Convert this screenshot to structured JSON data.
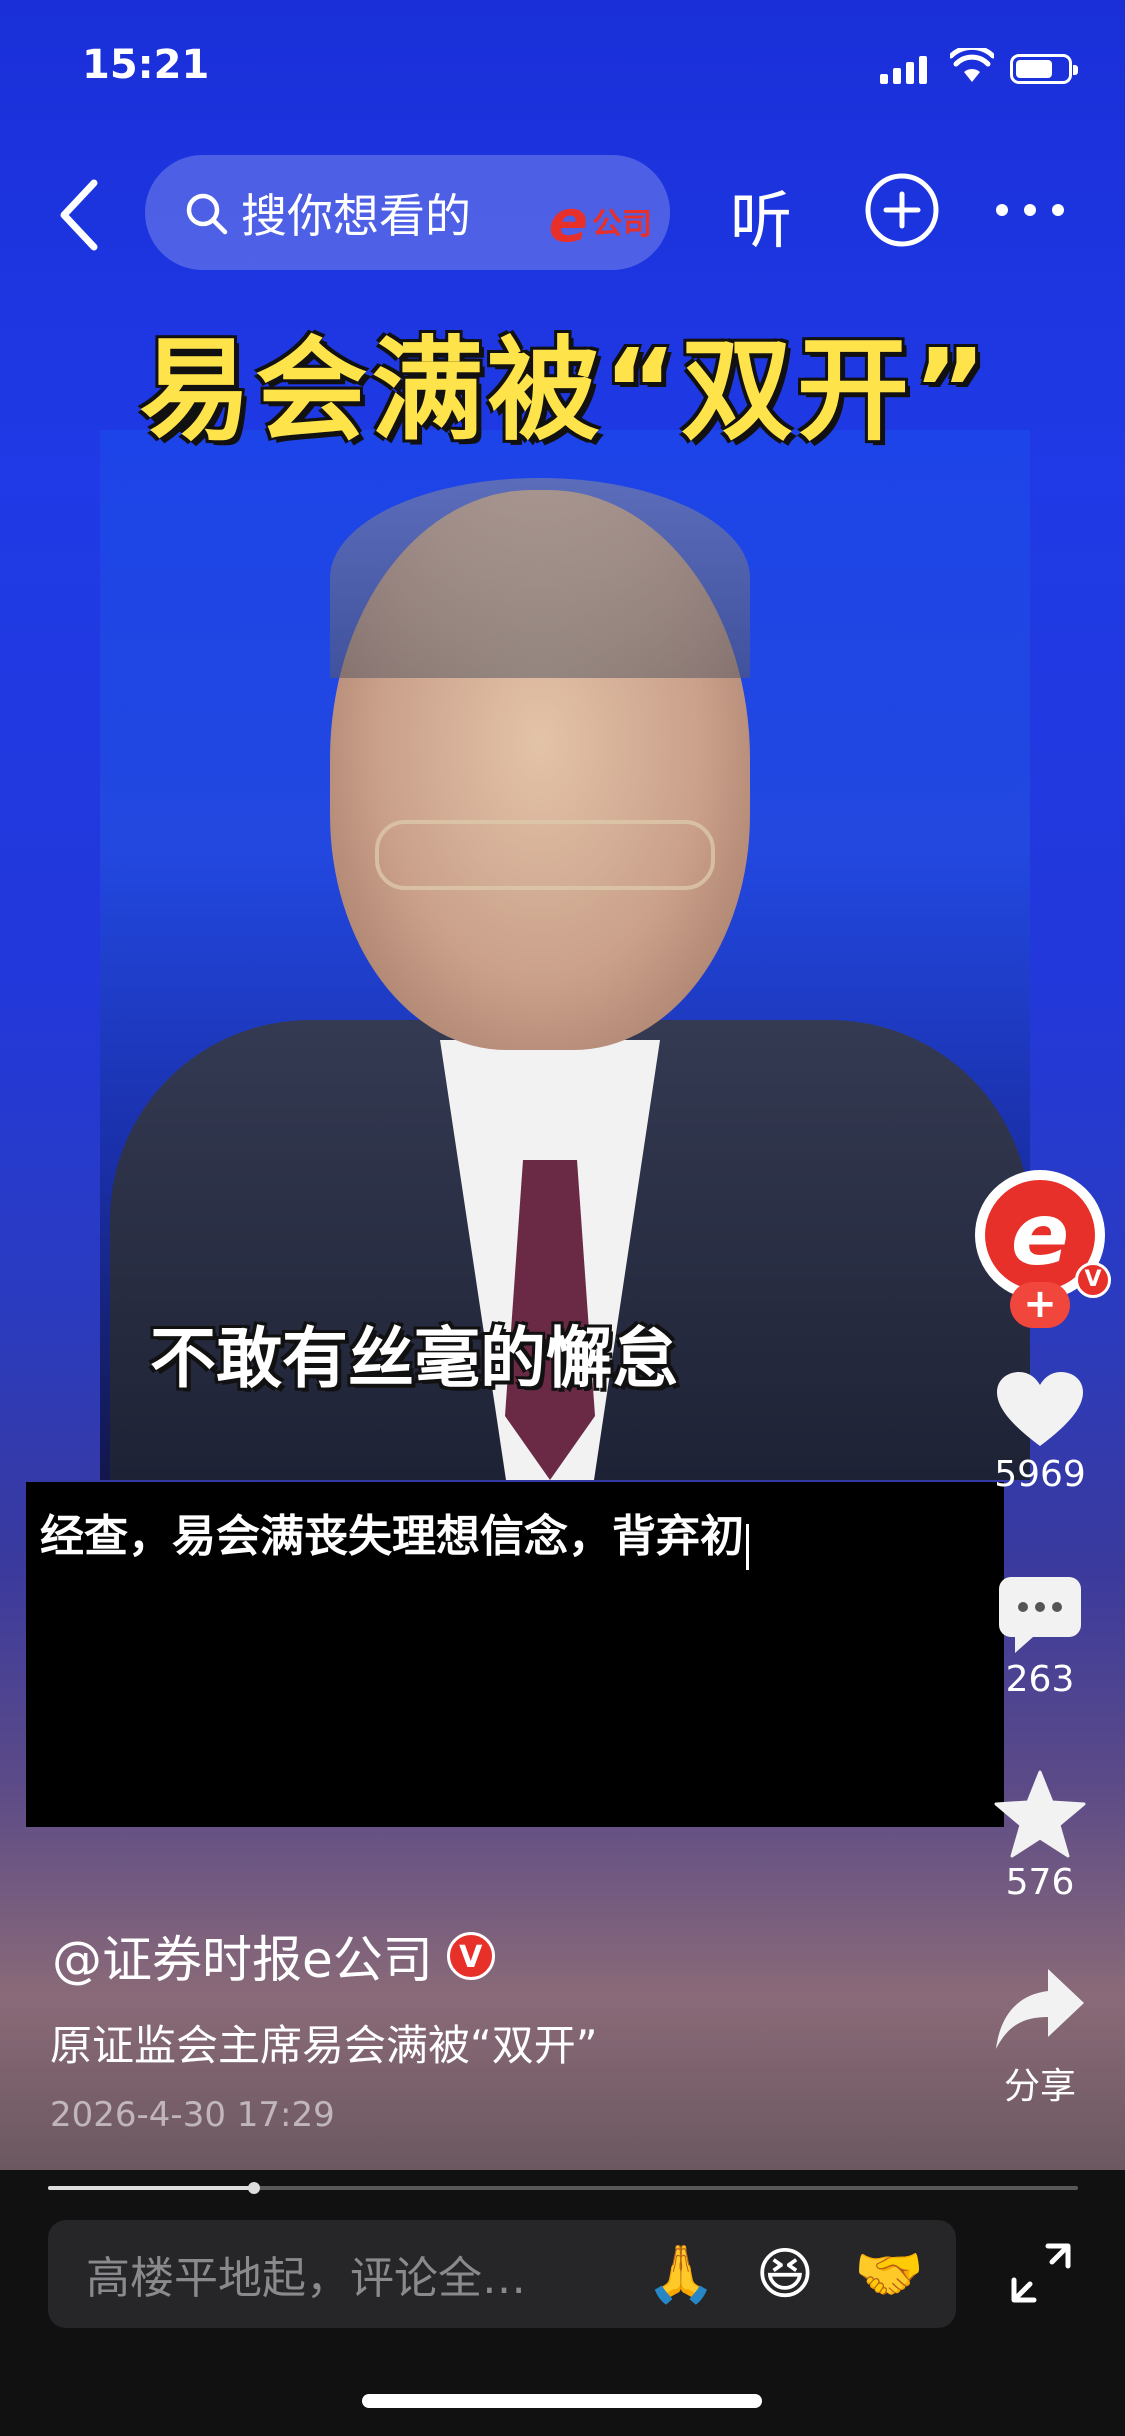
{
  "status_bar": {
    "time": "15:21",
    "battery_level": 0.75
  },
  "top_bar": {
    "search_placeholder": "搜你想看的",
    "search_logo_e": "e",
    "search_logo_word": "公司",
    "listen_label": "听"
  },
  "video": {
    "title_overlay": "易会满被“双开”",
    "subtitle_overlay": "不敢有丝毫的懈怠",
    "caption_text": "经查，易会满丧失理想信念，背弃初"
  },
  "rail": {
    "avatar_letter": "e",
    "follow_label": "+",
    "verified_label": "V",
    "likes": "5969",
    "comments": "263",
    "favorites": "576",
    "share_label": "分享"
  },
  "post": {
    "author": "@证券时报e公司",
    "author_badge": "V",
    "description": "原证监会主席易会满被“双开”",
    "date": "2026-4-30 17:29"
  },
  "bottom_bar": {
    "comment_placeholder": "高楼平地起，评论全…",
    "emojis": [
      "🙏",
      "😆",
      "🤝"
    ],
    "progress": 0.2
  },
  "colors": {
    "accent_red": "#e8302a",
    "title_yellow": "#ffe34a",
    "backdrop_blue": "#1f3ae6"
  }
}
